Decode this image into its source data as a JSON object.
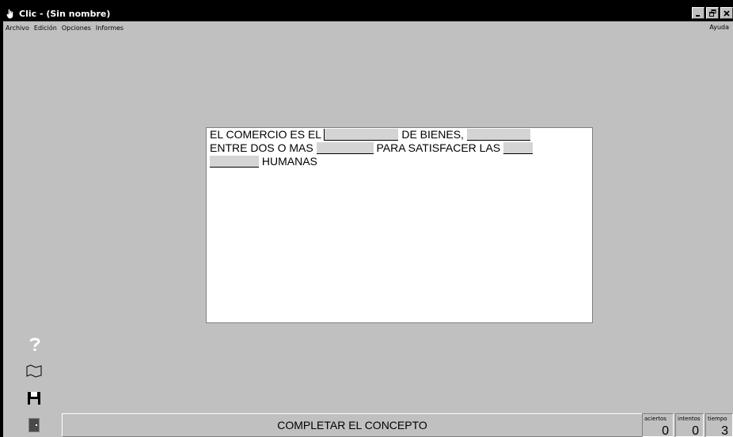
{
  "window": {
    "title": "Clic - (Sin nombre)",
    "controls": [
      "minimize",
      "restore",
      "close"
    ]
  },
  "menubar": {
    "items": [
      "Archivo",
      "Edición",
      "Opciones",
      "Informes"
    ],
    "help": "Ayuda"
  },
  "activity": {
    "lines": [
      [
        "EL COMERCIO ES EL",
        "DE BIENES,"
      ],
      [
        "ENTRE DOS O MAS",
        "PARA SATISFACER LAS"
      ],
      [
        "HUMANAS"
      ]
    ],
    "blank_color": "#d4d4d4"
  },
  "sidebar": {
    "icons": [
      "help-icon",
      "flag-icon",
      "save-icon",
      "exit-icon"
    ]
  },
  "status": {
    "concept": "COMPLETAR EL CONCEPTO",
    "aciertos_label": "aciertos",
    "aciertos_value": "0",
    "intentos_label": "intentos",
    "intentos_value": "0",
    "tiempo_label": "tiempo",
    "tiempo_value": "3"
  },
  "colors": {
    "workspace": "#c0c0c0",
    "titlebar": "#000000"
  }
}
